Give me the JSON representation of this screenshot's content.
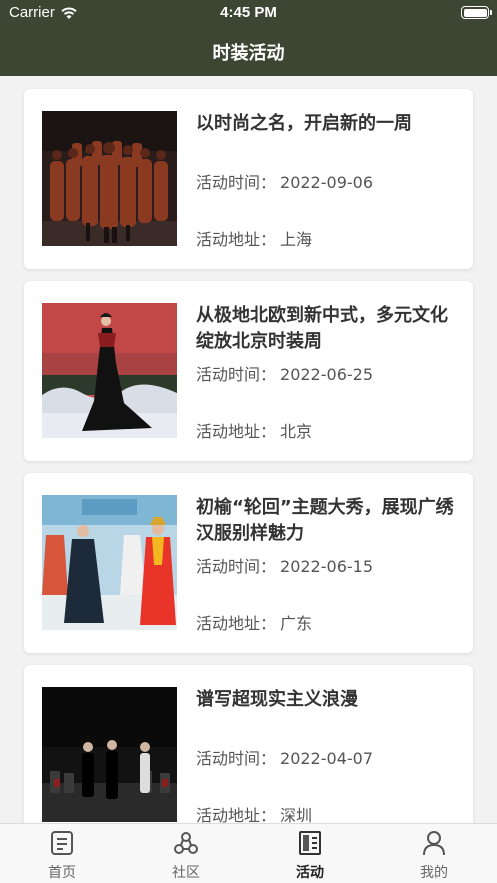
{
  "status": {
    "carrier": "Carrier",
    "time": "4:45 PM"
  },
  "nav": {
    "title": "时装活动"
  },
  "labels": {
    "time": "活动时间：",
    "address": "活动地址："
  },
  "events": [
    {
      "title": "以时尚之名，开启新的一周",
      "date": "2022-09-06",
      "address": "上海",
      "image": "runway-group-red"
    },
    {
      "title": "从极地北欧到新中式，多元文化绽放北京时装周",
      "date": "2022-06-25",
      "address": "北京",
      "image": "black-gown-model"
    },
    {
      "title": "初榆“轮回”主题大秀，展现广绣汉服别样魅力",
      "date": "2022-06-15",
      "address": "广东",
      "image": "hanfu-runway"
    },
    {
      "title": "谱写超现实主义浪漫",
      "date": "2022-04-07",
      "address": "深圳",
      "image": "dark-stage-runway"
    }
  ],
  "tabs": [
    {
      "label": "首页",
      "icon": "document-icon",
      "active": false
    },
    {
      "label": "社区",
      "icon": "community-icon",
      "active": false
    },
    {
      "label": "活动",
      "icon": "activity-icon",
      "active": true
    },
    {
      "label": "我的",
      "icon": "user-icon",
      "active": false
    }
  ],
  "colors": {
    "nav_bg": "#3d4633",
    "page_bg": "#f2f2f2",
    "card_bg": "#ffffff"
  }
}
